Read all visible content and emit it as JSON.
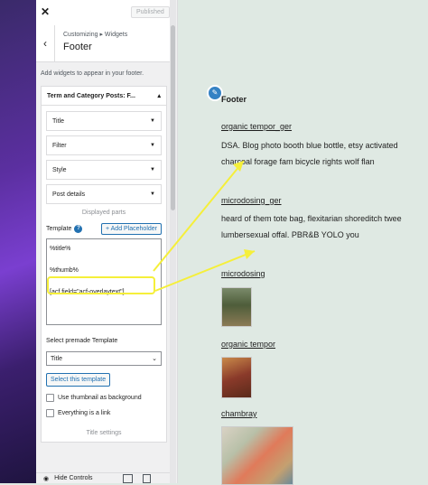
{
  "panel": {
    "published_label": "Published",
    "breadcrumb": "Customizing ▸ Widgets",
    "title": "Footer",
    "description": "Add widgets to appear in your footer.",
    "widget_title": "Term and Category Posts: F...",
    "accordions": [
      "Title",
      "Filter",
      "Style",
      "Post details"
    ],
    "displayed_parts": "Displayed parts",
    "template_label": "Template",
    "add_placeholder": "+ Add Placeholder",
    "template_lines": [
      "%title%",
      "%thumb%",
      "[acf field=\"acf-overlaytext\"]"
    ],
    "premade_label": "Select premade Template",
    "premade_value": "Title",
    "select_template_button": "Select this template",
    "checkbox_thumbnail": "Use thumbnail as background",
    "checkbox_link": "Everything is a link",
    "title_settings": "Title settings",
    "hide_controls": "Hide Controls"
  },
  "preview": {
    "footer_title": "Footer",
    "posts": [
      {
        "title": "organic tempor_ger",
        "text": "DSA. Blog photo booth blue bottle, etsy activated charcoal forage fam bicycle rights wolf flan"
      },
      {
        "title": "microdosing_ger",
        "text": "heard of them tote bag, flexitarian shoreditch twee lumbersexual offal. PBR&B YOLO you"
      },
      {
        "title": "microdosing"
      },
      {
        "title": "organic tempor"
      },
      {
        "title": "chambray"
      }
    ]
  },
  "colors": {
    "accent": "#2271b1",
    "highlight": "#f5ef3a",
    "preview_bg": "#dfe9e3"
  }
}
